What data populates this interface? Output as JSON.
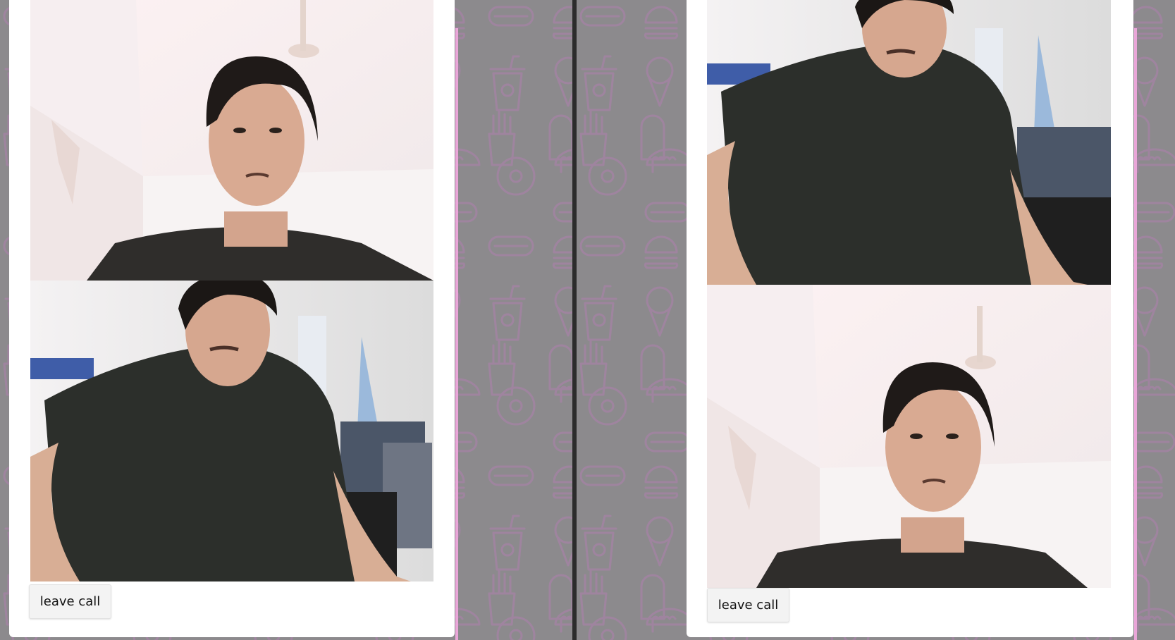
{
  "left_window": {
    "call": {
      "videos": [
        {
          "name": "remote-stream",
          "content": "webcam-face-front"
        },
        {
          "name": "local-stream",
          "content": "webcam-person-at-desk"
        }
      ],
      "leave_call_label": "leave call"
    }
  },
  "right_window": {
    "call": {
      "videos": [
        {
          "name": "remote-stream",
          "content": "webcam-person-at-desk"
        },
        {
          "name": "local-stream",
          "content": "webcam-face-front"
        }
      ],
      "leave_call_label": "leave call"
    }
  },
  "background_pattern_icons": [
    "hotdog-icon",
    "burger-icon",
    "ice-cream-icon",
    "soda-cup-icon",
    "fries-icon",
    "donut-icon",
    "taco-icon",
    "popsicle-icon"
  ],
  "colors": {
    "page_background": "#8c8a8d",
    "pattern_stroke": "#a582a6",
    "panel": "#ffffff",
    "accent_pink": "#e9a6d8",
    "window_separator": "#2c2c2c"
  }
}
